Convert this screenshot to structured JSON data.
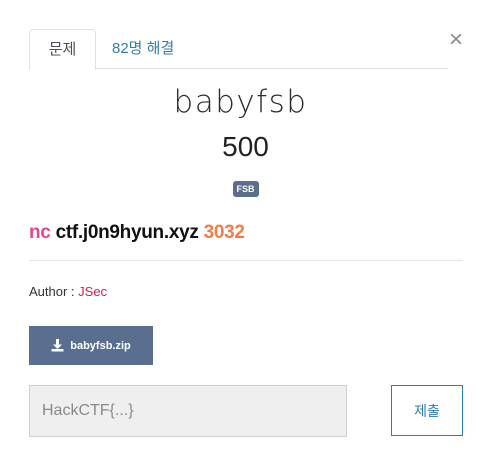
{
  "tabs": [
    {
      "label": "문제",
      "active": true
    },
    {
      "label": "82명 해결",
      "active": false
    }
  ],
  "close_icon": "close-icon",
  "challenge": {
    "name": "babyfsb",
    "points": "500",
    "tag": "FSB",
    "connection": {
      "command": "nc",
      "host": "ctf.j0n9hyun.xyz",
      "port": "3032"
    },
    "author_label": "Author :",
    "author_name": "JSec",
    "file": {
      "name": "babyfsb.zip",
      "icon": "download-icon"
    }
  },
  "submission": {
    "placeholder": "HackCTF{...}",
    "value": "",
    "submit_label": "제출"
  },
  "colors": {
    "tab_link": "#2f7fae",
    "nc": "#e8458b",
    "port": "#f07d4a",
    "author_link": "#d6204e",
    "file_button": "#5a6f8f",
    "tag_bg": "#5b6e8c"
  }
}
